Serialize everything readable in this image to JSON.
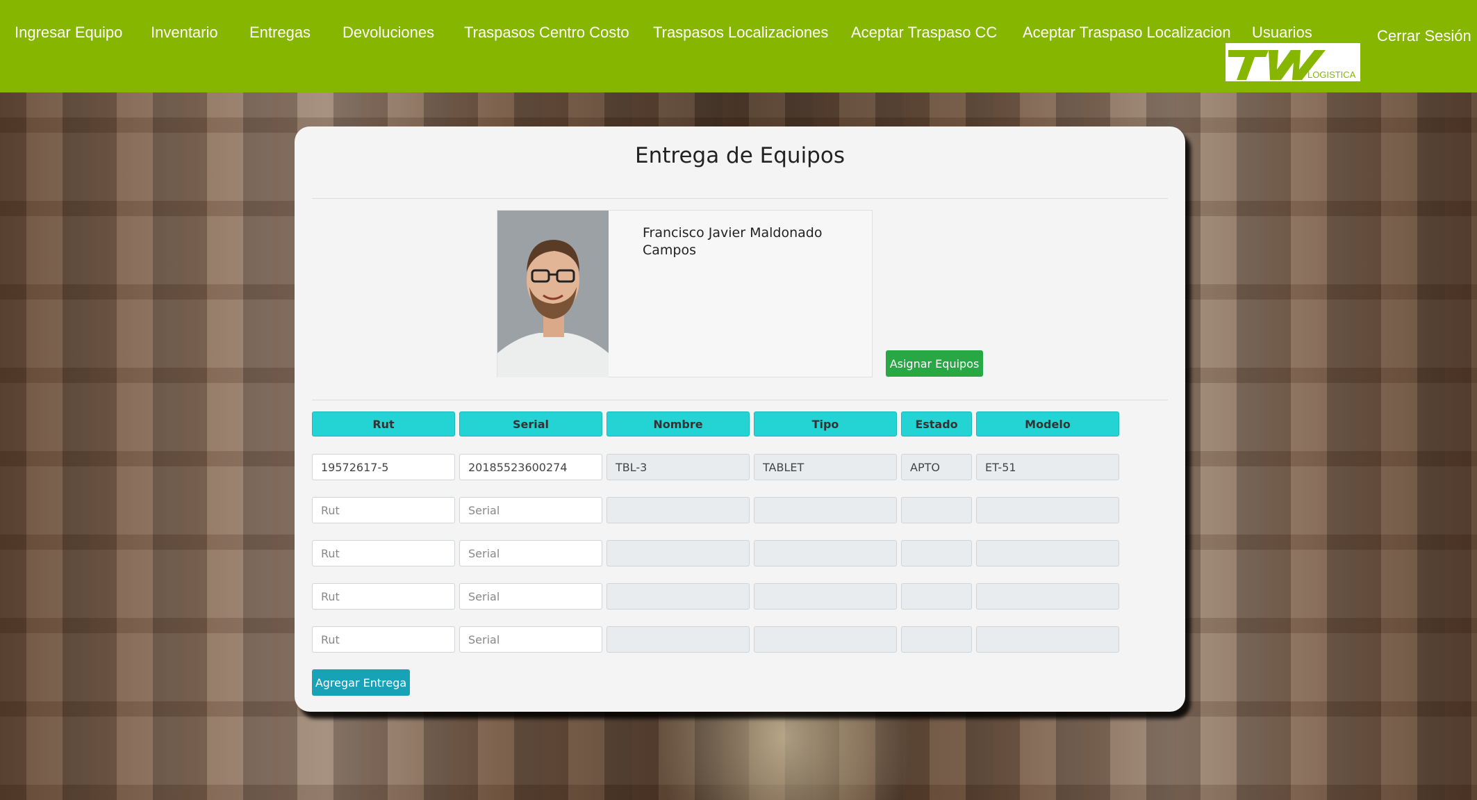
{
  "nav": {
    "items": [
      "Ingresar Equipo",
      "Inventario",
      "Entregas",
      "Devoluciones",
      "Traspasos Centro Costo",
      "Traspasos Localizaciones",
      "Aceptar Traspaso CC",
      "Aceptar Traspaso Localizacion",
      "Usuarios"
    ],
    "logout_label": "Cerrar Sesión",
    "logo_text": "TW",
    "logo_subtext": "LOGISTICA",
    "background_color": "#86b600"
  },
  "page": {
    "title": "Entrega de Equipos"
  },
  "profile": {
    "name": "Francisco Javier Maldonado Campos",
    "photo_icon": "person-photo"
  },
  "buttons": {
    "assign_label": "Asignar Equipos",
    "add_label": "Agregar Entrega"
  },
  "table": {
    "headers": [
      "Rut",
      "Serial",
      "Nombre",
      "Tipo",
      "Estado",
      "Modelo"
    ],
    "rows": [
      [
        "19572617-5",
        "20185523600274",
        "TBL-3",
        "TABLET",
        "APTO",
        "ET-51"
      ],
      [
        "",
        "",
        "",
        "",
        "",
        ""
      ],
      [
        "",
        "",
        "",
        "",
        "",
        ""
      ],
      [
        "",
        "",
        "",
        "",
        "",
        ""
      ],
      [
        "",
        "",
        "",
        "",
        "",
        ""
      ]
    ],
    "placeholders": [
      "Rut",
      "Serial",
      "",
      "",
      "",
      ""
    ]
  },
  "colors": {
    "header_cyan": "#24d4d4",
    "assign_green": "#28a745",
    "add_teal": "#17a2b8"
  }
}
